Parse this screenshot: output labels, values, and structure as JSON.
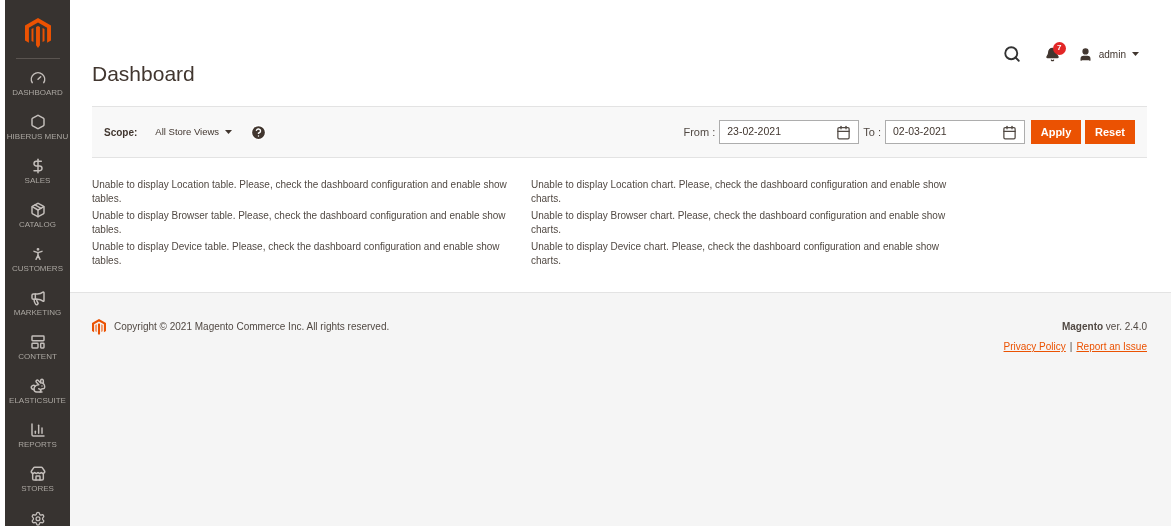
{
  "sidebar": {
    "items": [
      {
        "label": "DASHBOARD"
      },
      {
        "label": "HIBERUS MENU"
      },
      {
        "label": "SALES"
      },
      {
        "label": "CATALOG"
      },
      {
        "label": "CUSTOMERS"
      },
      {
        "label": "MARKETING"
      },
      {
        "label": "CONTENT"
      },
      {
        "label": "ELASTICSUITE"
      },
      {
        "label": "REPORTS"
      },
      {
        "label": "STORES"
      }
    ]
  },
  "header": {
    "title": "Dashboard",
    "notifications": "7",
    "user": "admin"
  },
  "filter": {
    "scope_label": "Scope:",
    "scope_value": "All Store Views",
    "from_label": "From :",
    "from_value": "23-02-2021",
    "to_label": "To :",
    "to_value": "02-03-2021",
    "apply": "Apply",
    "reset": "Reset"
  },
  "messages": [
    [
      "Unable to display Location table. Please, check the dashboard configuration and enable show tables.",
      "Unable to display Location chart. Please, check the dashboard configuration and enable show charts."
    ],
    [
      "Unable to display Browser table. Please, check the dashboard configuration and enable show tables.",
      "Unable to display Browser chart. Please, check the dashboard configuration and enable show charts."
    ],
    [
      "Unable to display Device table. Please, check the dashboard configuration and enable show tables.",
      "Unable to display Device chart. Please, check the dashboard configuration and enable show charts."
    ]
  ],
  "footer": {
    "copyright": "Copyright © 2021 Magento Commerce Inc. All rights reserved.",
    "version": "**Magento** ver. 2.4.0",
    "links": [
      "Privacy Policy",
      "Report an Issue"
    ],
    "separator": "|"
  }
}
